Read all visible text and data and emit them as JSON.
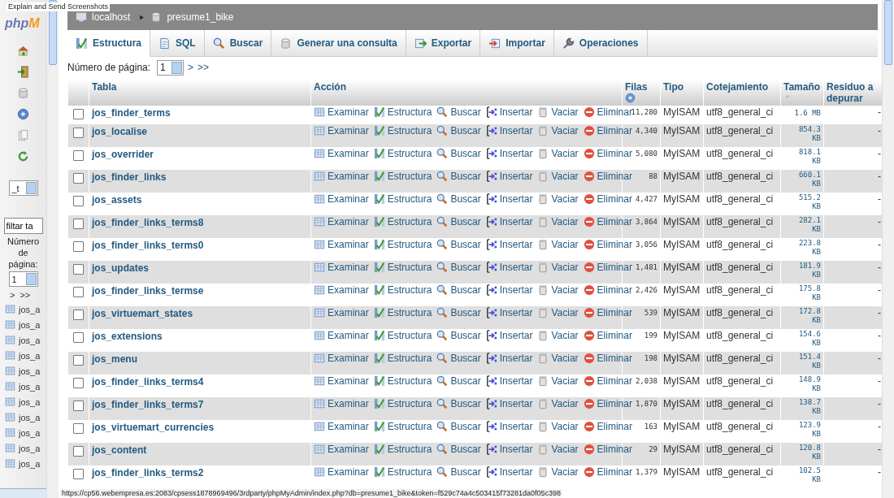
{
  "overlay_caption": "Explain and Send Screenshots",
  "sidebar": {
    "logo_parts": [
      "php",
      "M"
    ],
    "db_select": "_t",
    "filter": "filtar ta",
    "page_label": "Número de página:",
    "page_select": "1",
    "page_links": [
      ">",
      ">>"
    ],
    "tables": [
      "jos_a",
      "jos_a",
      "jos_a",
      "jos_a",
      "jos_a",
      "jos_a",
      "jos_a",
      "jos_a",
      "jos_a",
      "jos_a",
      "jos_a"
    ]
  },
  "breadcrumb": [
    "localhost",
    "presume1_bike"
  ],
  "tabs": [
    {
      "label": "Estructura",
      "selected": true
    },
    {
      "label": "SQL",
      "selected": false
    },
    {
      "label": "Buscar",
      "selected": false
    },
    {
      "label": "Generar una consulta",
      "selected": false
    },
    {
      "label": "Exportar",
      "selected": false
    },
    {
      "label": "Importar",
      "selected": false
    },
    {
      "label": "Operaciones",
      "selected": false
    }
  ],
  "pagination": {
    "label": "Número de página:",
    "select": "1",
    "links": [
      ">",
      ">>"
    ]
  },
  "table": {
    "columns": [
      "Tabla",
      "Acción",
      "Filas",
      "Tipo",
      "Cotejamiento",
      "Tamaño",
      "Residuo a depurar"
    ],
    "rows": [
      {
        "checked": false,
        "name": "jos_finder_terms",
        "actions": [
          "Examinar",
          "Estructura",
          "Buscar",
          "Insertar",
          "Vaciar",
          "Eliminar"
        ],
        "rows": "11,280",
        "type": "MyISAM",
        "collation": "utf8_general_ci",
        "size": "1.6 MB",
        "overhead": "-"
      },
      {
        "checked": false,
        "name": "jos_localise",
        "actions": [
          "Examinar",
          "Estructura",
          "Buscar",
          "Insertar",
          "Vaciar",
          "Eliminar"
        ],
        "rows": "4,340",
        "type": "MyISAM",
        "collation": "utf8_general_ci",
        "size": "854.3 KB",
        "overhead": "-"
      },
      {
        "checked": false,
        "name": "jos_overrider",
        "actions": [
          "Examinar",
          "Estructura",
          "Buscar",
          "Insertar",
          "Vaciar",
          "Eliminar"
        ],
        "rows": "5,080",
        "type": "MyISAM",
        "collation": "utf8_general_ci",
        "size": "818.1 KB",
        "overhead": "-"
      },
      {
        "checked": false,
        "name": "jos_finder_links",
        "actions": [
          "Examinar",
          "Estructura",
          "Buscar",
          "Insertar",
          "Vaciar",
          "Eliminar"
        ],
        "rows": "88",
        "type": "MyISAM",
        "collation": "utf8_general_ci",
        "size": "660.1 KB",
        "overhead": "-"
      },
      {
        "checked": false,
        "name": "jos_assets",
        "actions": [
          "Examinar",
          "Estructura",
          "Buscar",
          "Insertar",
          "Vaciar",
          "Eliminar"
        ],
        "rows": "4,427",
        "type": "MyISAM",
        "collation": "utf8_general_ci",
        "size": "515.2 KB",
        "overhead": "-"
      },
      {
        "checked": false,
        "name": "jos_finder_links_terms8",
        "actions": [
          "Examinar",
          "Estructura",
          "Buscar",
          "Insertar",
          "Vaciar",
          "Eliminar"
        ],
        "rows": "3,864",
        "type": "MyISAM",
        "collation": "utf8_general_ci",
        "size": "282.1 KB",
        "overhead": "-"
      },
      {
        "checked": false,
        "name": "jos_finder_links_terms0",
        "actions": [
          "Examinar",
          "Estructura",
          "Buscar",
          "Insertar",
          "Vaciar",
          "Eliminar"
        ],
        "rows": "3,056",
        "type": "MyISAM",
        "collation": "utf8_general_ci",
        "size": "223.8 KB",
        "overhead": "-"
      },
      {
        "checked": false,
        "name": "jos_updates",
        "actions": [
          "Examinar",
          "Estructura",
          "Buscar",
          "Insertar",
          "Vaciar",
          "Eliminar"
        ],
        "rows": "1,481",
        "type": "MyISAM",
        "collation": "utf8_general_ci",
        "size": "181.9 KB",
        "overhead": "-"
      },
      {
        "checked": false,
        "name": "jos_finder_links_termse",
        "actions": [
          "Examinar",
          "Estructura",
          "Buscar",
          "Insertar",
          "Vaciar",
          "Eliminar"
        ],
        "rows": "2,426",
        "type": "MyISAM",
        "collation": "utf8_general_ci",
        "size": "175.8 KB",
        "overhead": "-"
      },
      {
        "checked": false,
        "name": "jos_virtuemart_states",
        "actions": [
          "Examinar",
          "Estructura",
          "Buscar",
          "Insertar",
          "Vaciar",
          "Eliminar"
        ],
        "rows": "539",
        "type": "MyISAM",
        "collation": "utf8_general_ci",
        "size": "172.8 KB",
        "overhead": "-"
      },
      {
        "checked": false,
        "name": "jos_extensions",
        "actions": [
          "Examinar",
          "Estructura",
          "Buscar",
          "Insertar",
          "Vaciar",
          "Eliminar"
        ],
        "rows": "199",
        "type": "MyISAM",
        "collation": "utf8_general_ci",
        "size": "154.6 KB",
        "overhead": "-"
      },
      {
        "checked": false,
        "name": "jos_menu",
        "actions": [
          "Examinar",
          "Estructura",
          "Buscar",
          "Insertar",
          "Vaciar",
          "Eliminar"
        ],
        "rows": "198",
        "type": "MyISAM",
        "collation": "utf8_general_ci",
        "size": "151.4 KB",
        "overhead": "-"
      },
      {
        "checked": false,
        "name": "jos_finder_links_terms4",
        "actions": [
          "Examinar",
          "Estructura",
          "Buscar",
          "Insertar",
          "Vaciar",
          "Eliminar"
        ],
        "rows": "2,038",
        "type": "MyISAM",
        "collation": "utf8_general_ci",
        "size": "148.9 KB",
        "overhead": "-"
      },
      {
        "checked": false,
        "name": "jos_finder_links_terms7",
        "actions": [
          "Examinar",
          "Estructura",
          "Buscar",
          "Insertar",
          "Vaciar",
          "Eliminar"
        ],
        "rows": "1,870",
        "type": "MyISAM",
        "collation": "utf8_general_ci",
        "size": "138.7 KB",
        "overhead": "-"
      },
      {
        "checked": false,
        "name": "jos_virtuemart_currencies",
        "actions": [
          "Examinar",
          "Estructura",
          "Buscar",
          "Insertar",
          "Vaciar",
          "Eliminar"
        ],
        "rows": "163",
        "type": "MyISAM",
        "collation": "utf8_general_ci",
        "size": "123.9 KB",
        "overhead": "-"
      },
      {
        "checked": false,
        "name": "jos_content",
        "actions": [
          "Examinar",
          "Estructura",
          "Buscar",
          "Insertar",
          "Vaciar",
          "Eliminar"
        ],
        "rows": "29",
        "type": "MyISAM",
        "collation": "utf8_general_ci",
        "size": "120.8 KB",
        "overhead": "-"
      },
      {
        "checked": false,
        "name": "jos_finder_links_terms2",
        "actions": [
          "Examinar",
          "Estructura",
          "Buscar",
          "Insertar",
          "Vaciar",
          "Eliminar"
        ],
        "rows": "1,379",
        "type": "MyISAM",
        "collation": "utf8_general_ci",
        "size": "102.5 KB",
        "overhead": "-"
      }
    ]
  },
  "status_url": "https://cp56.webempresa.es:2083/cpsess1878969496/3rdparty/phpMyAdmin/index.php?db=presume1_bike&token=f529c74a4c503415f73281da0f05c398"
}
